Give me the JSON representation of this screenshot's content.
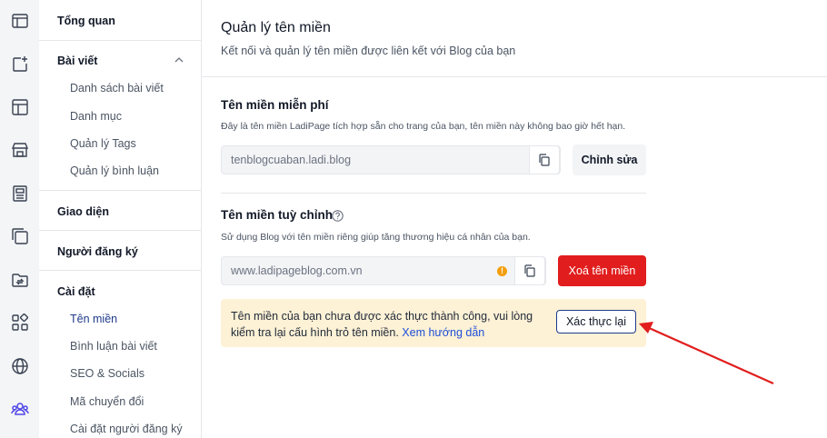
{
  "iconbar": {
    "icons": [
      "layout-panel-icon",
      "new-post-icon",
      "template-icon",
      "store-icon",
      "newspaper-icon",
      "layers-icon",
      "folder-sync-icon",
      "apps-grid-icon",
      "globe-icon",
      "users-icon"
    ],
    "active_color": "#4f46e5"
  },
  "sidebar": {
    "overview": "Tổng quan",
    "posts": "Bài viết",
    "post_list": "Danh sách bài viết",
    "categories": "Danh mục",
    "tags": "Quản lý Tags",
    "comments": "Quản lý bình luận",
    "interface": "Giao diện",
    "subscribers": "Người đăng ký",
    "settings": "Cài đặt",
    "domain": "Tên miền",
    "post_comments": "Bình luận bài viết",
    "seo": "SEO & Socials",
    "conversion": "Mã chuyển đổi",
    "subscriber_settings": "Cài đặt người đăng ký"
  },
  "main": {
    "title": "Quản lý tên miền",
    "subtitle": "Kết nối và quản lý tên miền được liên kết với Blog của bạn",
    "free": {
      "title": "Tên miền miễn phí",
      "desc": "Đây là tên miền LadiPage tích hợp sẵn cho trang của bạn, tên miền này không bao giờ hết hạn.",
      "value": "tenblogcuaban.ladi.blog",
      "edit_label": "Chỉnh sửa"
    },
    "custom": {
      "title": "Tên miền tuỳ chỉnh",
      "desc": "Sử dụng Blog với tên miền riêng giúp tăng thương hiệu cá nhân của bạn.",
      "value": "www.ladipageblog.com.vn",
      "warn_glyph": "!",
      "delete_label": "Xoá tên miền"
    },
    "alert": {
      "text": "Tên miền của bạn chưa được xác thực thành công, vui lòng kiểm tra lại cấu hình trỏ tên miền.",
      "link": "Xem hướng dẫn",
      "button": "Xác thực lại"
    }
  },
  "colors": {
    "danger": "#e11d1d",
    "warning_bg": "#fdf1d6",
    "link": "#1d4ed8",
    "annotation_arrow": "#e11d1d"
  }
}
